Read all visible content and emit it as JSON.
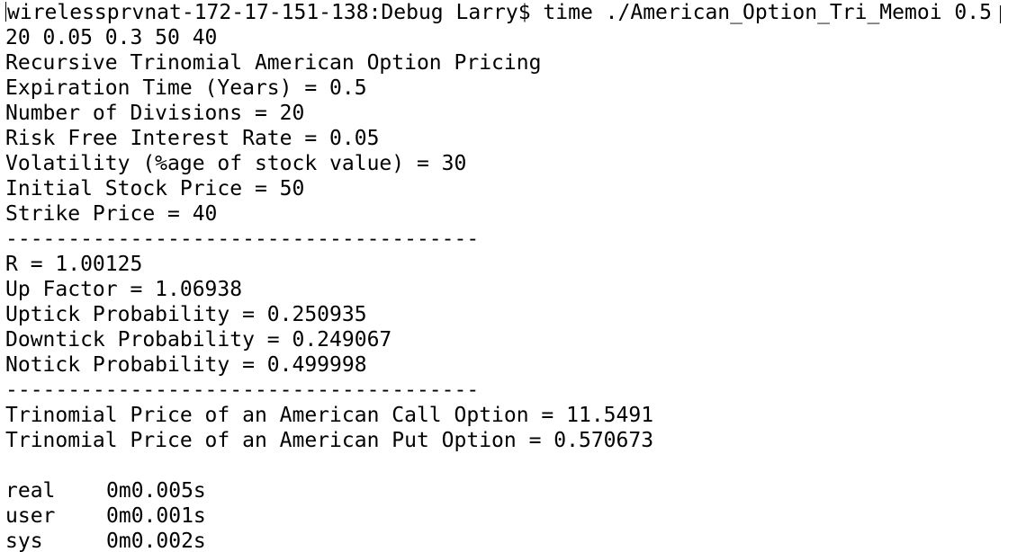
{
  "terminal": {
    "prompt_line": "wirelessprvnat-172-17-151-138:Debug Larry$ time ./American_Option_Tri_Memoi 0.5",
    "args_continuation": "20 0.05 0.3 50 40",
    "heading": "Recursive Trinomial American Option Pricing",
    "params": [
      "Expiration Time (Years) = 0.5",
      "Number of Divisions = 20",
      "Risk Free Interest Rate = 0.05",
      "Volatility (%age of stock value) = 30",
      "Initial Stock Price = 50",
      "Strike Price = 40"
    ],
    "separator_1": "--------------------------------------",
    "results": [
      "R = 1.00125",
      "Up Factor = 1.06938",
      "Uptick Probability = 0.250935",
      "Downtick Probability = 0.249067",
      "Notick Probability = 0.499998"
    ],
    "separator_2": "--------------------------------------",
    "prices": [
      "Trinomial Price of an American Call Option = 11.5491",
      "Trinomial Price of an American Put Option = 0.570673"
    ],
    "timing": [
      {
        "label": "real",
        "value": "0m0.005s"
      },
      {
        "label": "user",
        "value": "0m0.001s"
      },
      {
        "label": "sys",
        "value": "0m0.002s"
      }
    ]
  }
}
